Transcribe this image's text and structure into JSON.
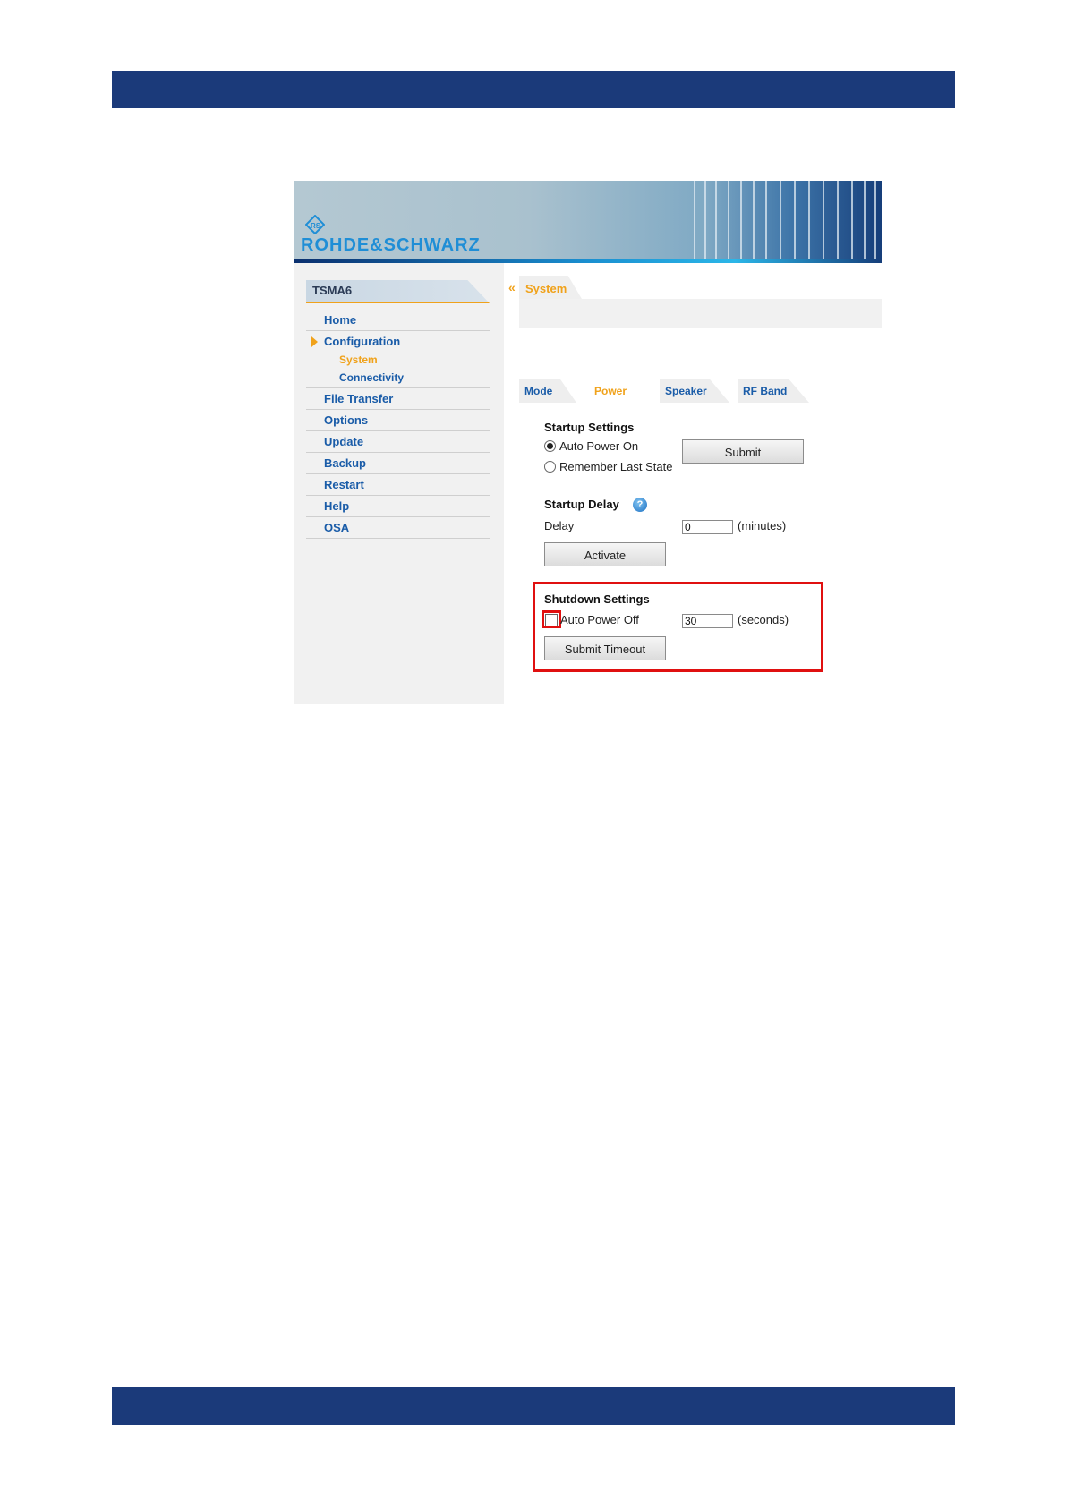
{
  "brand": {
    "logo_text": "ROHDE&SCHWARZ",
    "accent": "#f0a21b",
    "link": "#1a5ca8",
    "highlight": "#e01010",
    "band": "#1b3a7a"
  },
  "sidebar": {
    "device": "TSMA6",
    "items": [
      {
        "label": "Home"
      },
      {
        "label": "Configuration",
        "expanded": true
      },
      {
        "label": "System",
        "sub": true,
        "active": true
      },
      {
        "label": "Connectivity",
        "sub": true
      },
      {
        "label": "File Transfer"
      },
      {
        "label": "Options"
      },
      {
        "label": "Update"
      },
      {
        "label": "Backup"
      },
      {
        "label": "Restart"
      },
      {
        "label": "Help"
      },
      {
        "label": "OSA"
      }
    ]
  },
  "breadcrumb": {
    "label": "System"
  },
  "tabs": [
    {
      "label": "Mode"
    },
    {
      "label": "Power",
      "active": true
    },
    {
      "label": "Speaker"
    },
    {
      "label": "RF Band"
    }
  ],
  "startup": {
    "title": "Startup Settings",
    "option_auto": "Auto Power On",
    "option_remember": "Remember Last State",
    "selected": "Auto Power On",
    "submit": "Submit"
  },
  "delay": {
    "title": "Startup Delay",
    "help_icon": "question-circle-icon",
    "label": "Delay",
    "value": "0",
    "unit": "(minutes)",
    "activate": "Activate"
  },
  "shutdown": {
    "title": "Shutdown Settings",
    "auto_off_label": "Auto Power Off",
    "auto_off_checked": false,
    "value": "30",
    "unit": "(seconds)",
    "submit": "Submit Timeout"
  }
}
